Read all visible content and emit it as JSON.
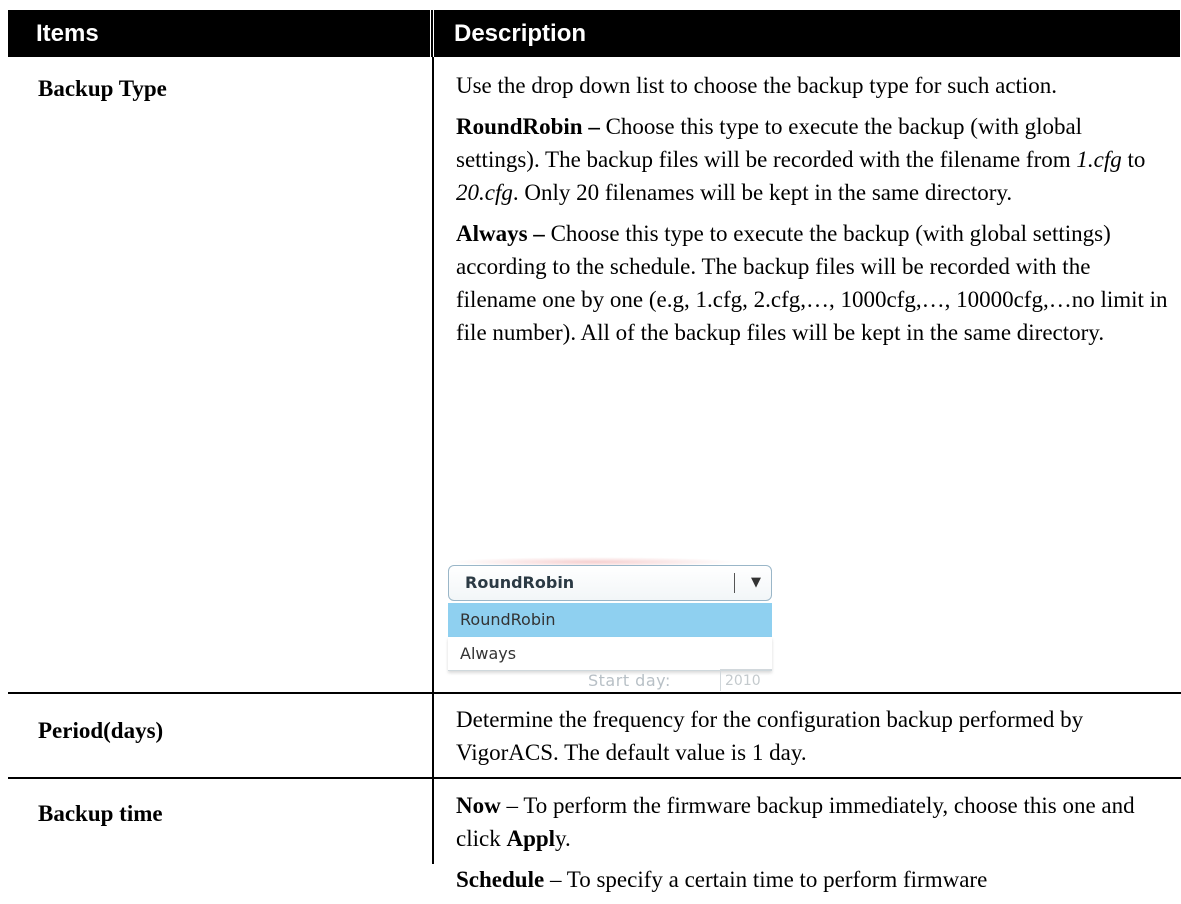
{
  "header": {
    "items": "Items",
    "description": "Description"
  },
  "rows": [
    {
      "item": "Backup Type",
      "p1": "Use the drop down list to choose the backup type for such action.",
      "p2": {
        "term": "RoundRobin –",
        "t1": " Choose this type to execute the backup (with global settings). The backup files will be recorded with the filename from ",
        "i1": "1.cfg",
        "t2": " to ",
        "i2": "20.cfg",
        "t3": ". Only 20 filenames will be kept in the same directory."
      },
      "p3": {
        "term": "Always –",
        "t1": " Choose this type to execute the backup (with global settings) according to the schedule. The backup files will be recorded with the filename one by one (e.g, 1.cfg, 2.cfg,…, 1000cfg,…, 10000cfg,…no limit in file number). All of the backup files will be kept in the same directory."
      },
      "dropdown": {
        "selected": "RoundRobin",
        "options": [
          "RoundRobin",
          "Always"
        ],
        "ghost_label": "Start day:",
        "ghost_value": "2010",
        "arrow_icon": "chevron-down-icon"
      }
    },
    {
      "item": "Period(days)",
      "p1": "Determine the frequency for the configuration backup performed by VigorACS. The default value is 1 day."
    },
    {
      "item": "Backup time",
      "p1": {
        "term": "Now",
        "t1": " – To perform the firmware backup immediately, choose this one and click ",
        "term2": "Appl",
        "t2": "y."
      },
      "p2": {
        "term": "Schedule",
        "t1": " – To specify a certain time to perform firmware"
      }
    }
  ],
  "colors": {
    "header_bg": "#000000",
    "header_fg": "#ffffff",
    "highlight_option": "#8fd0f0"
  }
}
